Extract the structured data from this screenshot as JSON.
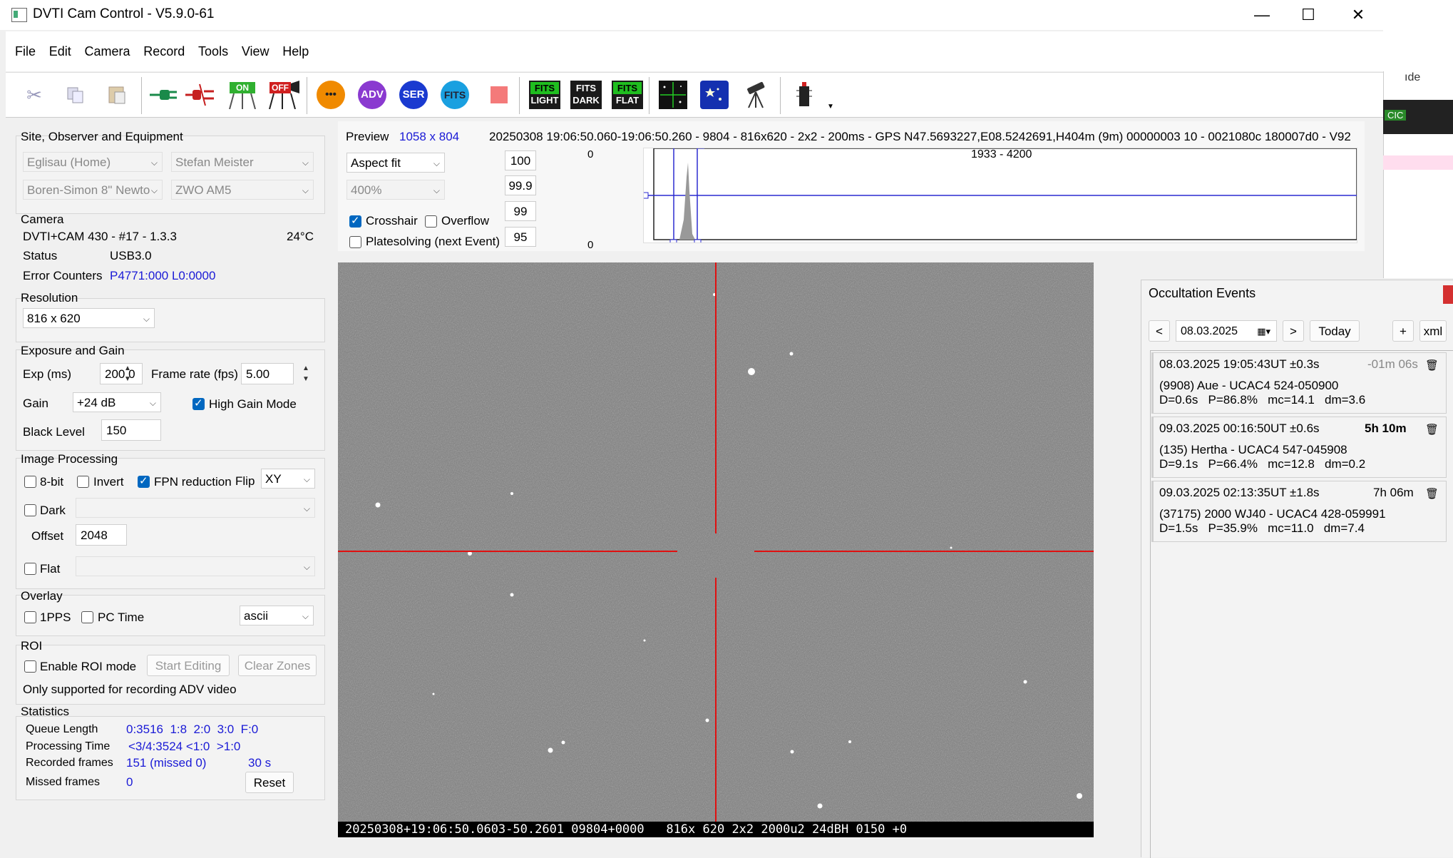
{
  "window": {
    "title": "DVTI Cam Control - V5.9.0-61",
    "minimize": "—",
    "maximize": "☐",
    "close": "✕"
  },
  "menu": [
    "File",
    "Edit",
    "Camera",
    "Record",
    "Tools",
    "View",
    "Help"
  ],
  "toolbar": {
    "icons": [
      "cut-icon",
      "copy-icon",
      "paste-icon",
      "connect-icon",
      "disconnect-icon",
      "camera-on-icon",
      "camera-off-icon",
      "more-icon",
      "adv-icon",
      "ser-icon",
      "fits-icon",
      "stop-icon",
      "fits-light-icon",
      "fits-dark-icon",
      "fits-flat-icon",
      "crosshair-icon",
      "platesolve-icon",
      "telescope-icon",
      "device-icon"
    ],
    "adv": "ADV",
    "ser": "SER",
    "fits": "FITS",
    "on": "ON",
    "off": "OFF",
    "fits_label": "FITS",
    "light": "LIGHT",
    "dark": "DARK",
    "flat": "FLAT",
    "more": "•••"
  },
  "site": {
    "title": "Site, Observer and Equipment",
    "site_value": "Eglisau (Home)",
    "observer_value": "Stefan Meister",
    "telescope_value": "Boren-Simon 8\" Newto",
    "mount_value": "ZWO AM5"
  },
  "camera": {
    "title": "Camera",
    "model": "DVTI+CAM 430  -  #17  -  1.3.3",
    "temp": "24°C",
    "status_label": "Status",
    "status_value": "USB3.0",
    "errors_label": "Error Counters",
    "errors_value": "P4771:000 L0:0000"
  },
  "resolution": {
    "title": "Resolution",
    "value": "816 x 620"
  },
  "exposure": {
    "title": "Exposure and Gain",
    "exp_label": "Exp (ms)",
    "exp_value": "200.0",
    "fps_label": "Frame rate (fps)",
    "fps_value": "5.00",
    "gain_label": "Gain",
    "gain_value": "+24 dB",
    "high_gain_label": "High Gain Mode",
    "high_gain": true,
    "black_label": "Black Level",
    "black_value": "150"
  },
  "processing": {
    "title": "Image Processing",
    "bit8": "8-bit",
    "invert": "Invert",
    "fpn": "FPN reduction",
    "fpn_on": true,
    "flip_label": "Flip",
    "flip_value": "XY",
    "dark": "Dark",
    "offset_label": "Offset",
    "offset_value": "2048",
    "flat": "Flat"
  },
  "overlay": {
    "title": "Overlay",
    "pps": "1PPS",
    "pctime": "PC Time",
    "format_value": "ascii"
  },
  "roi": {
    "title": "ROI",
    "enable": "Enable ROI mode",
    "start": "Start Editing",
    "clear": "Clear Zones",
    "note": "Only supported for recording ADV video"
  },
  "stats": {
    "title": "Statistics",
    "queue_label": "Queue Length",
    "queue_value": "0:3516  1:8  2:0  3:0  F:0",
    "proc_label": "Processing Time",
    "proc_value": "<3/4:3524 <1:0  >1:0",
    "rec_label": "Recorded frames",
    "rec_value": "151 (missed 0)",
    "rec_time": "30 s",
    "missed_label": "Missed frames",
    "missed_value": "0",
    "reset": "Reset"
  },
  "preview": {
    "label": "Preview",
    "size": "1058 x 804",
    "info": "20250308 19:06:50.060-19:06:50.260 - 9804 - 816x620 - 2x2 - 200ms - GPS N47.5693227,E08.5242691,H404m (9m) 00000003 10 - 0021080c 180007d0 - V92",
    "fit_value": "Aspect fit",
    "zoom_value": "400%",
    "crosshair": "Crosshair",
    "crosshair_on": true,
    "overflow": "Overflow",
    "platesolve": "Platesolving (next Event)",
    "levels": [
      "100",
      "99.9",
      "99",
      "95"
    ],
    "histo_top": "0",
    "histo_bottom": "0",
    "histo_range": "1933 - 4200"
  },
  "image": {
    "footer": "20250308+19:06:50.0603-50.2601 09804+0000   816x 620 2x2 2000u2 24dBH 0150 +0"
  },
  "occultation": {
    "title": "Occultation Events",
    "prev": "<",
    "date": "08.03.2025",
    "next": ">",
    "today": "Today",
    "add": "+",
    "xml": "xml",
    "events": [
      {
        "time": "08.03.2025 19:05:43UT ±0.3s",
        "countdown": "-01m 06s",
        "bold": false,
        "muted": true,
        "name": "(9908) Aue - UCAC4 524-050900",
        "stats": "D=0.6s   P=86.8%   mc=14.1   dm=3.6"
      },
      {
        "time": "09.03.2025 00:16:50UT ±0.6s",
        "countdown": "5h 10m",
        "bold": true,
        "muted": false,
        "name": "(135) Hertha - UCAC4 547-045908",
        "stats": "D=9.1s   P=66.4%   mc=12.8   dm=0.2"
      },
      {
        "time": "09.03.2025 02:13:35UT ±1.8s",
        "countdown": "7h 06m",
        "bold": false,
        "muted": false,
        "name": "(37175) 2000 WJ40 - UCAC4 428-059991",
        "stats": "D=1.5s   P=35.9%   mc=11.0   dm=7.4"
      }
    ]
  },
  "bgapp": {
    "text1": "ıde",
    "text2": "CIC"
  }
}
